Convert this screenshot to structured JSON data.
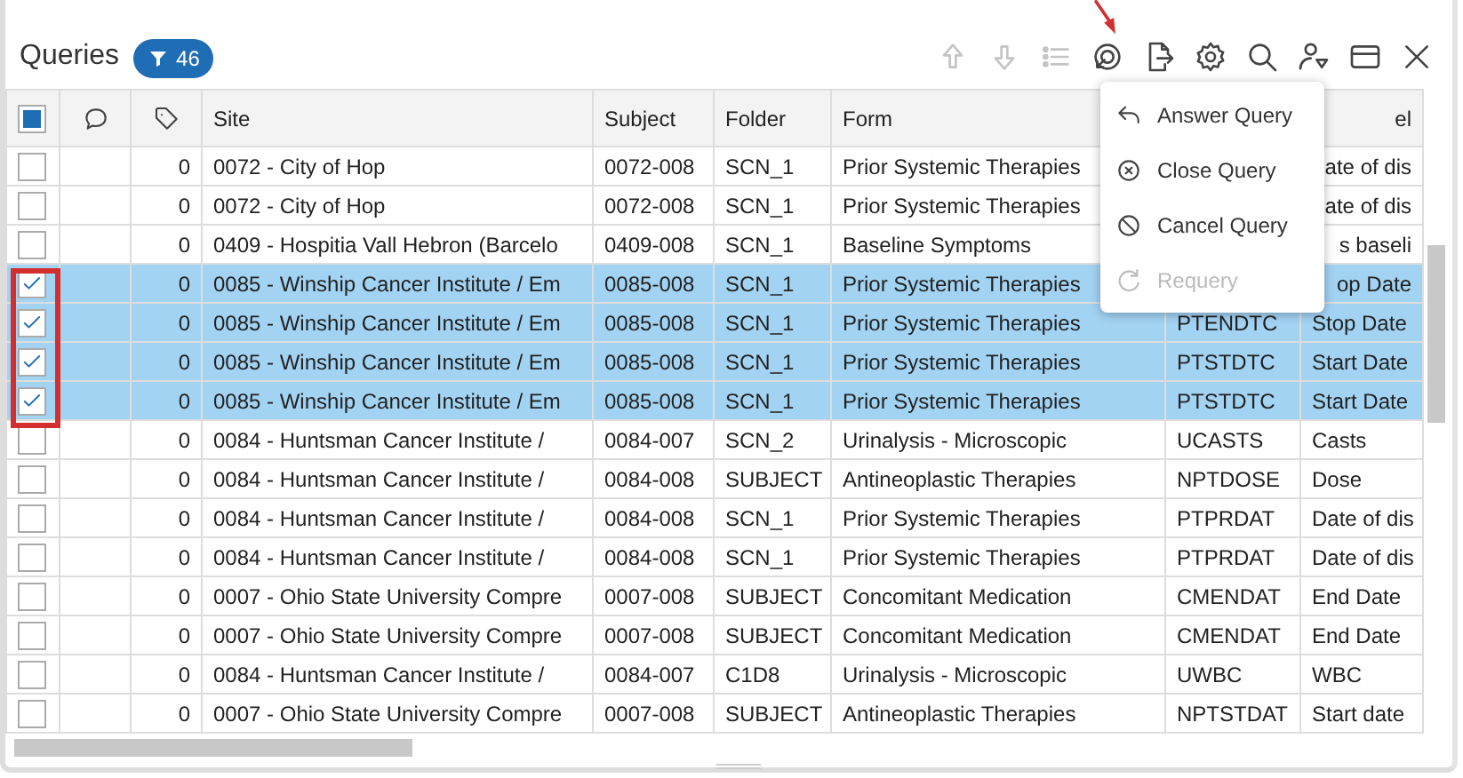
{
  "title": "Queries",
  "filter_badge": {
    "count": "46"
  },
  "toolbar": [
    {
      "kind": "up",
      "disabled": true
    },
    {
      "kind": "down",
      "disabled": true
    },
    {
      "kind": "list",
      "disabled": true
    },
    {
      "kind": "query",
      "disabled": false
    },
    {
      "kind": "export",
      "disabled": false
    },
    {
      "kind": "settings",
      "disabled": false
    },
    {
      "kind": "search",
      "disabled": false
    },
    {
      "kind": "user-filter",
      "disabled": false
    },
    {
      "kind": "window",
      "disabled": false
    },
    {
      "kind": "close",
      "disabled": false
    }
  ],
  "table": {
    "select_all": {
      "indeterminate": true
    },
    "columns": [
      "",
      "",
      "Site",
      "Subject",
      "Folder",
      "Form",
      null,
      "el"
    ],
    "rows": [
      {
        "selected": false,
        "cells": [
          "",
          "0",
          "0072 - City of Hop",
          "0072-008",
          "SCN_1",
          "Prior Systemic Therapies",
          null,
          "ate of dis"
        ]
      },
      {
        "selected": false,
        "cells": [
          "",
          "0",
          "0072 - City of Hop",
          "0072-008",
          "SCN_1",
          "Prior Systemic Therapies",
          null,
          "ate of dis"
        ]
      },
      {
        "selected": false,
        "cells": [
          "",
          "0",
          "0409 - Hospitia Vall Hebron (Barcelo",
          "0409-008",
          "SCN_1",
          "Baseline Symptoms",
          null,
          "s baseli"
        ]
      },
      {
        "selected": true,
        "cells": [
          "",
          "0",
          "0085 - Winship Cancer Institute / Em",
          "0085-008",
          "SCN_1",
          "Prior Systemic Therapies",
          null,
          "op Date"
        ]
      },
      {
        "selected": true,
        "cells": [
          "",
          "0",
          "0085 - Winship Cancer Institute / Em",
          "0085-008",
          "SCN_1",
          "Prior Systemic Therapies",
          "PTENDTC",
          "Stop Date"
        ]
      },
      {
        "selected": true,
        "cells": [
          "",
          "0",
          "0085 - Winship Cancer Institute / Em",
          "0085-008",
          "SCN_1",
          "Prior Systemic Therapies",
          "PTSTDTC",
          "Start Date"
        ]
      },
      {
        "selected": true,
        "cells": [
          "",
          "0",
          "0085 - Winship Cancer Institute / Em",
          "0085-008",
          "SCN_1",
          "Prior Systemic Therapies",
          "PTSTDTC",
          "Start Date"
        ]
      },
      {
        "selected": false,
        "cells": [
          "",
          "0",
          "0084 - Huntsman Cancer Institute /",
          "0084-007",
          "SCN_2",
          "Urinalysis - Microscopic",
          "UCASTS",
          "Casts"
        ]
      },
      {
        "selected": false,
        "cells": [
          "",
          "0",
          "0084 - Huntsman Cancer Institute /",
          "0084-008",
          "SUBJECT",
          "Antineoplastic Therapies",
          "NPTDOSE",
          "Dose"
        ]
      },
      {
        "selected": false,
        "cells": [
          "",
          "0",
          "0084 - Huntsman Cancer Institute /",
          "0084-008",
          "SCN_1",
          "Prior Systemic Therapies",
          "PTPRDAT",
          "Date of dis"
        ]
      },
      {
        "selected": false,
        "cells": [
          "",
          "0",
          "0084 - Huntsman Cancer Institute /",
          "0084-008",
          "SCN_1",
          "Prior Systemic Therapies",
          "PTPRDAT",
          "Date of dis"
        ]
      },
      {
        "selected": false,
        "cells": [
          "",
          "0",
          "0007 - Ohio State University Compre",
          "0007-008",
          "SUBJECT",
          "Concomitant Medication",
          "CMENDAT",
          "End Date"
        ]
      },
      {
        "selected": false,
        "cells": [
          "",
          "0",
          "0007 - Ohio State University Compre",
          "0007-008",
          "SUBJECT",
          "Concomitant Medication",
          "CMENDAT",
          "End Date"
        ]
      },
      {
        "selected": false,
        "cells": [
          "",
          "0",
          "0084 - Huntsman Cancer Institute /",
          "0084-007",
          "C1D8",
          "Urinalysis - Microscopic",
          "UWBC",
          "WBC"
        ]
      },
      {
        "selected": false,
        "cells": [
          "",
          "0",
          "0007 - Ohio State University Compre",
          "0007-008",
          "SUBJECT",
          "Antineoplastic Therapies",
          "NPTSTDAT",
          "Start date"
        ]
      }
    ]
  },
  "menu": [
    {
      "kind": "answer",
      "label": "Answer Query",
      "disabled": false
    },
    {
      "kind": "close",
      "label": "Close Query",
      "disabled": false
    },
    {
      "kind": "cancel",
      "label": "Cancel Query",
      "disabled": false
    },
    {
      "kind": "requery",
      "label": "Requery",
      "disabled": true
    }
  ]
}
